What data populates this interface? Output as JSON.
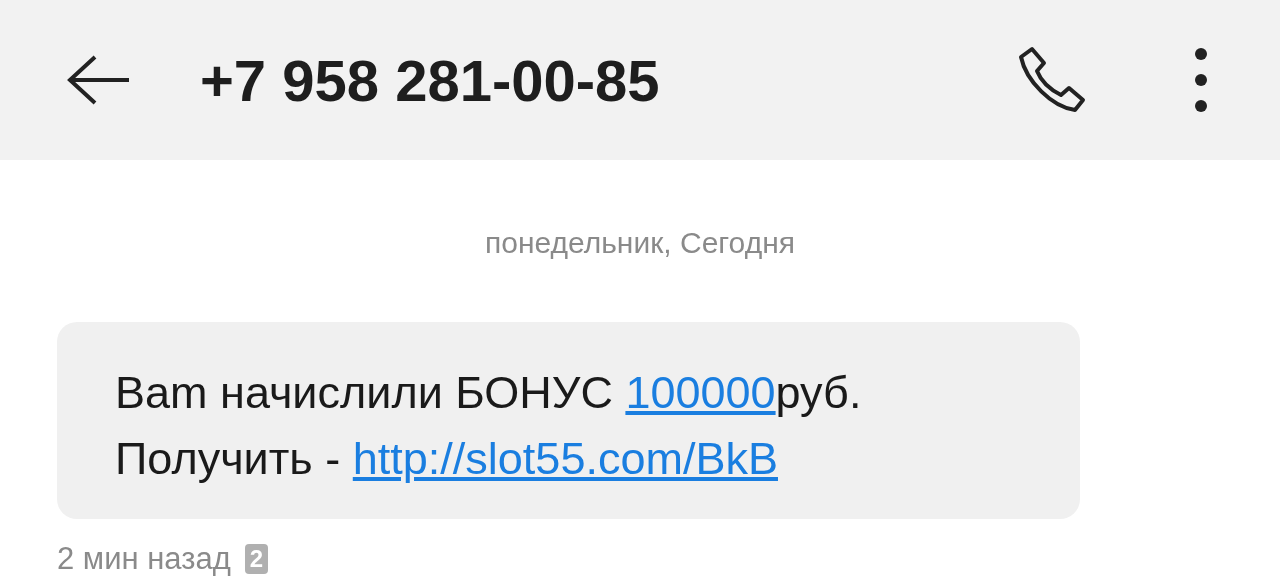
{
  "header": {
    "title": "+7 958 281-00-85"
  },
  "date_label": "понедельник, Сегодня",
  "message": {
    "lines": [
      [
        {
          "kind": "text",
          "text": "Вam начислили БОНУС "
        },
        {
          "kind": "link",
          "text": "100000"
        },
        {
          "kind": "text",
          "text": "руб."
        }
      ],
      [
        {
          "kind": "text",
          "text": "Получить - "
        },
        {
          "kind": "link",
          "text": "http://slot55.com/BkB"
        }
      ]
    ],
    "time": "2 мин назад",
    "sim": "2"
  }
}
